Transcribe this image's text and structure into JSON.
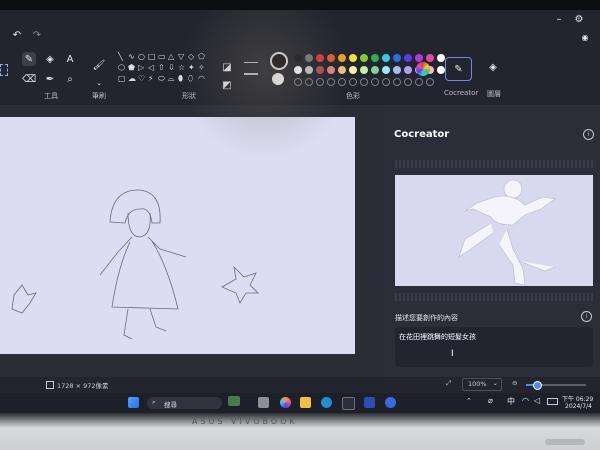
{
  "toolbar": {
    "groups": {
      "tools": "工具",
      "brushes": "筆刷",
      "shapes": "形狀",
      "colors": "色彩"
    },
    "cocreator_label": "Cocreator",
    "layers_label": "圖層",
    "tool_icons": [
      "pencil-icon",
      "fill-icon",
      "text-icon",
      "eraser-icon",
      "color-picker-icon",
      "magnifier-icon"
    ],
    "shape_glyphs": [
      "╲",
      "∿",
      "○",
      "□",
      "▭",
      "△",
      "▽",
      "◇",
      "⬠",
      "⬡",
      "⬟",
      "▷",
      "◁",
      "⇧",
      "⇩",
      "☆",
      "✦",
      "✧",
      "▢",
      "☁",
      "♡",
      "⚡",
      "⬭",
      "⌓",
      "⬮",
      "⬯",
      "◠"
    ],
    "colors_row1": [
      "#1a1a1a",
      "#7a7a7a",
      "#e03a3a",
      "#e85a2a",
      "#f0a020",
      "#f6e030",
      "#7fd02a",
      "#2ab04a",
      "#38c8f0",
      "#2a6ef0",
      "#5a3af0",
      "#b03ae0",
      "#e04ab0",
      "#ffffff"
    ],
    "colors_row2": [
      "#ffffff",
      "#c8c8c8",
      "#b05050",
      "#e88080",
      "#f0c080",
      "#fff0a0",
      "#c0f0a0",
      "#80d0a0",
      "#a0e8f8",
      "#a0c0f8",
      "#b0a0f8",
      "#e0a0f0",
      "#f8b0d8",
      "#ffffff"
    ]
  },
  "panel": {
    "title": "Cocreator",
    "prompt_label": "描述您要創作的內容",
    "prompt_value": "在花田裡跳舞的短髮女孩"
  },
  "status": {
    "dimensions": "1728 × 972像素",
    "zoom": "100%"
  },
  "taskbar": {
    "search_label": "搜尋",
    "ime": "中",
    "time": "下午 06:29",
    "date": "2024/7/4"
  },
  "laptop": {
    "brand": "ASUS VIVOBOOK"
  }
}
